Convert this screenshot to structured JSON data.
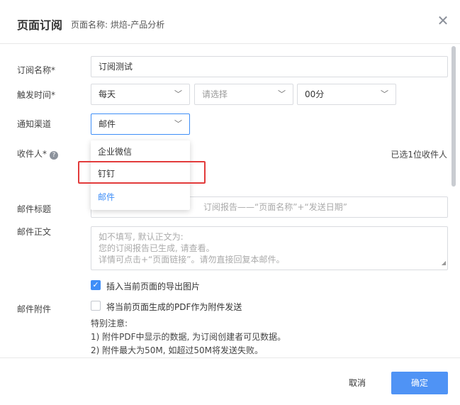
{
  "header": {
    "title": "页面订阅",
    "subtitle": "页面名称: 烘焙-产品分析",
    "close_icon": "close-icon"
  },
  "form": {
    "name": {
      "label": "订阅名称*",
      "value": "订阅测试"
    },
    "trigger": {
      "label": "触发时间*",
      "frequency": "每天",
      "day_placeholder": "请选择",
      "minute": "00分"
    },
    "channel": {
      "label": "通知渠道",
      "value": "邮件",
      "options": [
        "企业微信",
        "钉钉",
        "邮件"
      ],
      "selected_index": 2
    },
    "recipients": {
      "label": "收件人*",
      "count_text": "已选1位收件人"
    },
    "mail_title": {
      "label": "邮件标题",
      "placeholder": "订阅报告——“页面名称”+“发送日期”"
    },
    "mail_body": {
      "label": "邮件正文",
      "placeholder_lines": [
        "如不填写, 默认正文为:",
        "您的订阅报告已生成, 请查看。",
        "详情可点击+“页面链接”。请勿直接回复本邮件。"
      ]
    },
    "attachments": {
      "label": "邮件附件",
      "insert_image": {
        "label": "插入当前页面的导出图片",
        "checked": true
      },
      "pdf_attach": {
        "label": "将当前页面生成的PDF作为附件发送",
        "checked": false
      },
      "notes": [
        "特别注意:",
        "1) 附件PDF中显示的数据, 为订阅创建者可见数据。",
        "2) 附件最大为50M, 如超过50M将发送失败。"
      ]
    }
  },
  "footer": {
    "cancel_label": "取消",
    "ok_label": "确定"
  },
  "colors": {
    "accent": "#3f8ef7",
    "primary_button": "#4f93f5",
    "highlight": "#e23b3b"
  }
}
